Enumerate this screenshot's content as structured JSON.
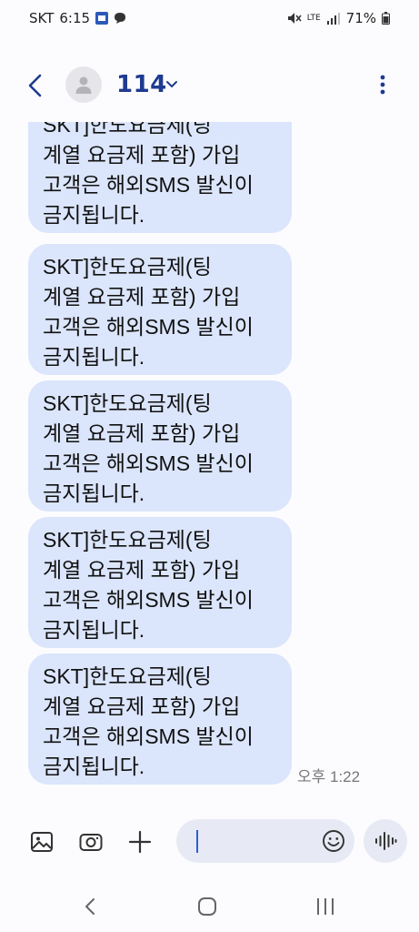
{
  "status_bar": {
    "carrier": "SKT",
    "time": "6:15",
    "network": "LTE",
    "battery": "71%"
  },
  "header": {
    "contact_name": "114"
  },
  "messages": [
    {
      "text": "SKT]한도요금제(팅\n계열 요금제 포함) 가입\n고객은 해외SMS 발신이\n금지됩니다."
    },
    {
      "text": "SKT]한도요금제(팅\n계열 요금제 포함) 가입\n고객은 해외SMS 발신이\n금지됩니다."
    },
    {
      "text": "SKT]한도요금제(팅\n계열 요금제 포함) 가입\n고객은 해외SMS 발신이\n금지됩니다."
    },
    {
      "text": "SKT]한도요금제(팅\n계열 요금제 포함) 가입\n고객은 해외SMS 발신이\n금지됩니다."
    },
    {
      "text": "SKT]한도요금제(팅\n계열 요금제 포함) 가입\n고객은 해외SMS 발신이\n금지됩니다."
    }
  ],
  "last_message_time": "오후 1:22",
  "icons": {
    "back": "chevron-left-icon",
    "more": "more-vertical-icon",
    "gallery": "image-icon",
    "camera": "camera-icon",
    "attach": "plus-icon",
    "emoji": "smiley-icon",
    "voice": "waveform-icon"
  },
  "colors": {
    "accent": "#1e3b8f",
    "bubble": "#dbe5fb",
    "field": "#e7eaf4"
  }
}
